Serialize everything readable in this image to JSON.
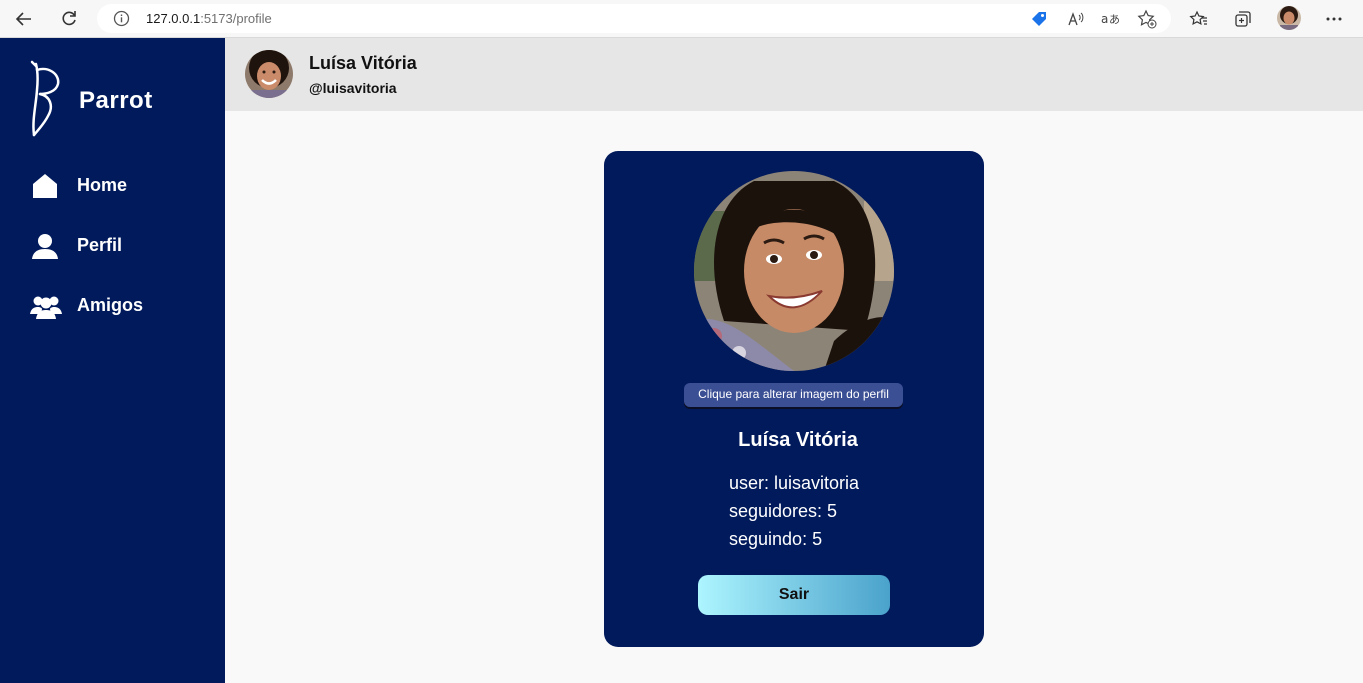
{
  "browser": {
    "url_host": "127.0.0.1",
    "url_rest": ":5173/profile",
    "icons": [
      "back-arrow-icon",
      "refresh-icon",
      "info-icon",
      "tag-icon",
      "read-aloud-icon",
      "translate-icon",
      "add-favorite-icon",
      "favorites-icon",
      "collections-icon",
      "more-icon"
    ]
  },
  "sidebar": {
    "brand": "Parrot",
    "items": [
      {
        "label": "Home",
        "icon": "home-icon"
      },
      {
        "label": "Perfil",
        "icon": "user-icon"
      },
      {
        "label": "Amigos",
        "icon": "friends-icon"
      }
    ]
  },
  "header": {
    "name": "Luísa Vitória",
    "handle": "@luisavitoria"
  },
  "profile": {
    "change_image_label": "Clique para alterar imagem do perfil",
    "name": "Luísa Vitória",
    "user_line": "user: luisavitoria",
    "followers_line": "seguidores: 5",
    "following_line": "seguindo: 5",
    "logout_label": "Sair"
  },
  "colors": {
    "sidebar": "#011a5c",
    "card": "#011a5c",
    "header": "#e6e6e6",
    "background": "#f9f9f9",
    "logout_gradient_start": "#adf5ff",
    "logout_gradient_end": "#4aa2cb"
  }
}
